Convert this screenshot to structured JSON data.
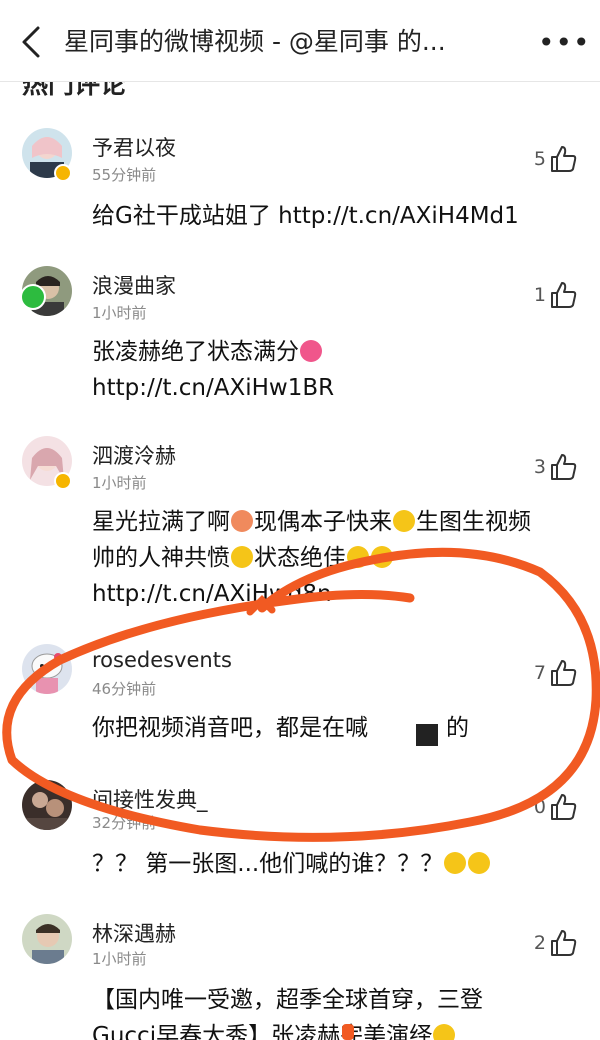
{
  "header": {
    "title": "星同事的微博视频 - @星同事 的...",
    "back_icon": "back-chevron-icon",
    "more_icon": "more-dots-icon",
    "more_label": "•••"
  },
  "section": {
    "title": "热门评论"
  },
  "comments": [
    {
      "username": "予君以夜",
      "time": "55分钟前",
      "likes": "5",
      "text": "给G社干成站姐了 http://t.cn/AXiH4Md1",
      "badge": "yellow-v-badge"
    },
    {
      "username": "浪漫曲家",
      "time": "1小时前",
      "likes": "1",
      "text_line1": "张凌赫绝了状态满分",
      "text_line2": "http://t.cn/AXiHw1BR",
      "badge": "green-check-badge"
    },
    {
      "username": "泗渡泠赫",
      "time": "1小时前",
      "likes": "3",
      "text_p1": "星光拉满了啊",
      "text_p2": "现偶本子快来",
      "text_p3": "生图生视频",
      "text_p4": "帅的人神共愤",
      "text_p5": "状态绝佳",
      "text_line3": "http://t.cn/AXiHwd8n",
      "badge": "yellow-v-badge"
    },
    {
      "username": "rosedesvents",
      "time": "46分钟前",
      "likes": "7",
      "text_a": "你把视频消音吧，都是在喊",
      "text_b": "的"
    },
    {
      "username": "间接性发典_",
      "time": "32分钟前",
      "likes": "0",
      "text": "？？ 第一张图...他们喊的谁？？？"
    },
    {
      "username": "林深遇赫",
      "time": "1小时前",
      "likes": "2",
      "text_line1": "【国内唯一受邀，超季全球首穿，三登",
      "text_line2": "Gucci早春大秀】张凌赫完美演绎"
    }
  ],
  "icons": {
    "like": "thumbs-up-icon"
  },
  "colors": {
    "annotation": "#f15a22",
    "badge_yellow": "#f6b500",
    "badge_green": "#2dbb3f"
  }
}
